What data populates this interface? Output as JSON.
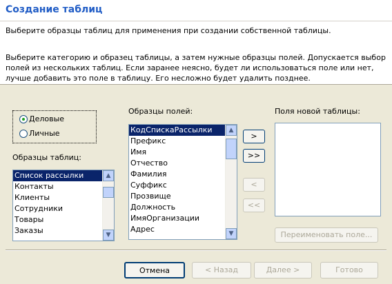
{
  "dialog": {
    "title": "Создание таблиц",
    "intro_line1": "Выберите образцы таблиц для применения при создании собственной таблицы.",
    "intro_line2": "Выберите категорию и образец таблицы, а затем нужные образцы полей. Допускается выбор полей из нескольких таблиц. Если заранее неясно, будет ли использоваться поле или нет, лучше добавить это поле в таблицу. Его несложно будет удалить позднее."
  },
  "category": {
    "options": [
      {
        "label": "Деловые",
        "selected": true
      },
      {
        "label": "Личные",
        "selected": false
      }
    ]
  },
  "table_samples": {
    "label": "Образцы таблиц:",
    "items": [
      "Список рассылки",
      "Контакты",
      "Клиенты",
      "Сотрудники",
      "Товары",
      "Заказы"
    ],
    "selected": "Список рассылки"
  },
  "field_samples": {
    "label": "Образцы полей:",
    "items": [
      "КодСпискаРассылки",
      "Префикс",
      "Имя",
      "Отчество",
      "Фамилия",
      "Суффикс",
      "Прозвище",
      "Должность",
      "ИмяОрганизации",
      "Адрес"
    ],
    "selected": "КодСпискаРассылки"
  },
  "new_fields": {
    "label": "Поля новой таблицы:",
    "items": []
  },
  "move_buttons": {
    "add_one": ">",
    "add_all": ">>",
    "remove_one": "<",
    "remove_all": "<<"
  },
  "rename_button": "Переименовать поле...",
  "footer": {
    "cancel": "Отмена",
    "back": "< Назад",
    "next": "Далее >",
    "finish": "Готово"
  }
}
